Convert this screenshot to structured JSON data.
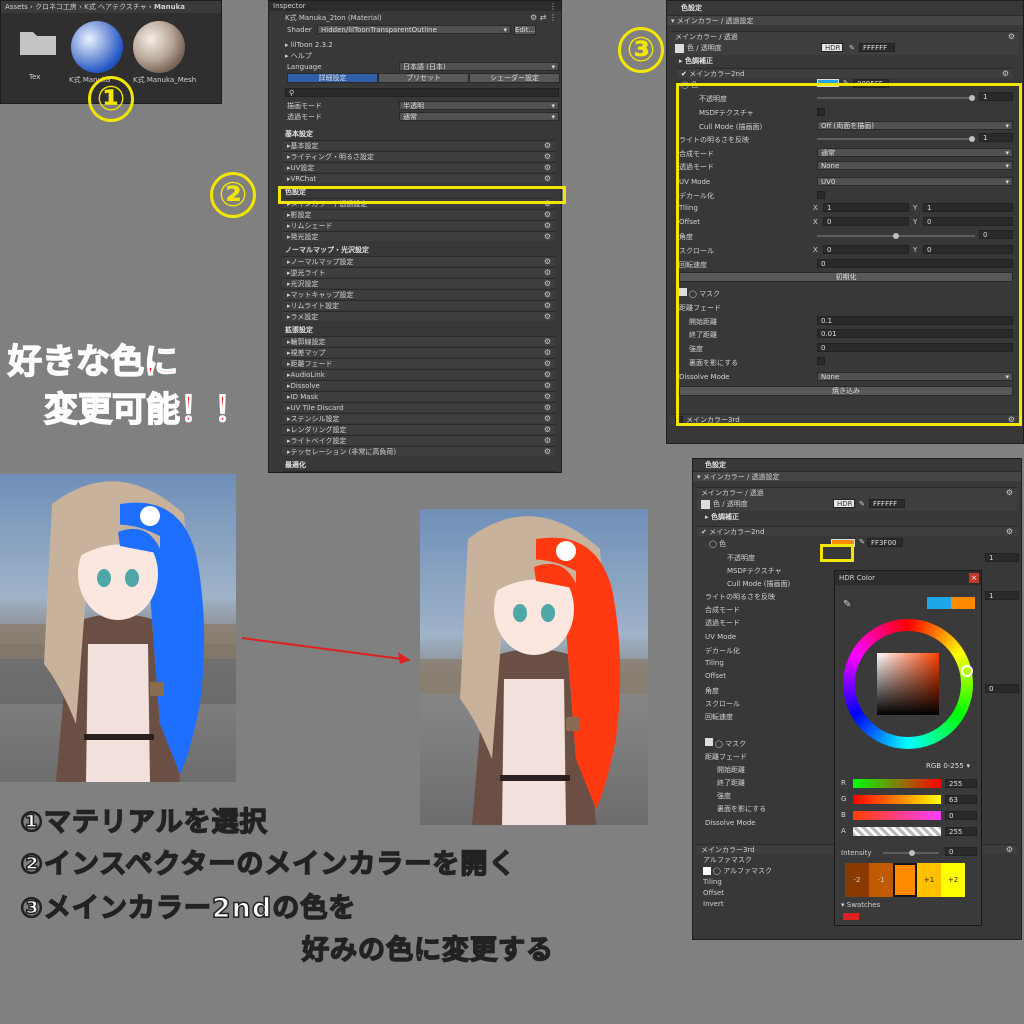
{
  "project": {
    "breadcrumb": [
      "Assets",
      "クロネコ工房",
      "K式 ヘアテクスチャ",
      "Manuka"
    ],
    "items": [
      {
        "label": "Tex"
      },
      {
        "label": "K式 Manuka"
      },
      {
        "label": "K式 Manuka_Mesh"
      }
    ]
  },
  "step_numbers": [
    "①",
    "②",
    "③"
  ],
  "inspector": {
    "tab": "Inspector",
    "title": "K式 Manuka_2ton (Material)",
    "shader_label": "Shader",
    "shader_value": "Hidden/lilToonTransparentOutline",
    "edit": "Edit...",
    "version": "lilToon 2.3.2",
    "help": "ヘルプ",
    "language_label": "Language",
    "language_value": "日本語 (日本)",
    "tabs": [
      "詳細設定",
      "プリセット",
      "シェーダー設定"
    ],
    "render_mode_label": "描画モード",
    "render_mode_value": "半透明",
    "transparent_mode_label": "透過モード",
    "transparent_mode_value": "通常",
    "groups": [
      {
        "title": "基本設定",
        "items": [
          "基本設定",
          "ライティング・明るさ設定",
          "UV設定",
          "VRChat"
        ]
      },
      {
        "title": "色設定",
        "items": [
          "メインカラー / 透過設定",
          "影設定",
          "リムシェード",
          "発光設定"
        ]
      },
      {
        "title": "ノーマルマップ・光沢設定",
        "items": [
          "ノーマルマップ設定",
          "逆光ライト",
          "光沢設定",
          "マットキャップ設定",
          "リムライト設定",
          "ラメ設定"
        ]
      },
      {
        "title": "拡張設定",
        "items": [
          "輪郭線設定",
          "視差マップ",
          "距離フェード",
          "AudioLink",
          "Dissolve",
          "ID Mask",
          "UV Tile Discard",
          "ステンシル設定",
          "レンダリング設定",
          "ライトベイク設定",
          "テッセレーション (非常に高負荷)"
        ]
      },
      {
        "title": "最適化",
        "items": [
          "最適化"
        ]
      }
    ]
  },
  "panel3": {
    "header": "色設定",
    "fold_main": "メインカラー / 透過設定",
    "sub_main": "メインカラー / 透過",
    "color_alpha": "色 / 透明度",
    "hdr": "HDR",
    "main_hex": "FFFFFF",
    "tone": "色調補正",
    "second_title": "メインカラー2nd",
    "color": "色",
    "second_hex": "0095FF",
    "opacity": "不透明度",
    "opacity_val": "1",
    "msdf": "MSDFテクスチャ",
    "cull_label": "Cull Mode (描画面)",
    "cull_value": "Off (両面を描画)",
    "light_label": "ライトの明るさを反映",
    "light_val": "1",
    "blend_label": "合成モード",
    "blend_value": "通常",
    "trans_label": "透過モード",
    "trans_value": "None",
    "uvmode_label": "UV Mode",
    "uvmode_value": "UV0",
    "decal": "デカール化",
    "tiling": "Tiling",
    "tx": "1",
    "ty": "1",
    "offset": "Offset",
    "ox": "0",
    "oy": "0",
    "angle": "角度",
    "angle_val": "0",
    "scroll": "スクロール",
    "sx": "0",
    "sy": "0",
    "rot": "回転速度",
    "rot_val": "0",
    "init": "初期化",
    "mask": "マスク",
    "distfade": "距離フェード",
    "start": "開始距離",
    "start_val": "0.1",
    "end": "終了距離",
    "end_val": "0.01",
    "strength": "強度",
    "strength_val": "0",
    "backface": "裏面を影にする",
    "dissolve": "Dissolve Mode",
    "dissolve_value": "None",
    "bake": "焼き込み",
    "third": "メインカラー3rd"
  },
  "panel4": {
    "header": "色設定",
    "fold_main": "メインカラー / 透過設定",
    "sub_main": "メインカラー / 透過",
    "color_alpha": "色 / 透明度",
    "hdr": "HDR",
    "main_hex": "FFFFFF",
    "tone": "色調補正",
    "second_title": "メインカラー2nd",
    "color": "色",
    "second_hex": "FF3F00",
    "opacity": "不透明度",
    "msdf": "MSDFテクスチャ",
    "cull": "Cull Mode (描画面)",
    "light": "ライトの明るさを反映",
    "blend": "合成モード",
    "trans": "透過モード",
    "uvmode": "UV Mode",
    "decal": "デカール化",
    "tiling": "Tiling",
    "offset": "Offset",
    "angle": "角度",
    "scroll": "スクロール",
    "rot": "回転速度",
    "mask": "マスク",
    "distfade": "距離フェード",
    "start": "開始距離",
    "end": "終了距離",
    "strength": "強度",
    "backface": "裏面を影にする",
    "dissolve": "Dissolve Mode",
    "third": "メインカラー3rd",
    "alphamask": "アルファマスク",
    "alphamask_item": "アルファマスク",
    "tiling2": "Tiling",
    "offset2": "Offset",
    "invert": "Invert",
    "right_vals": [
      "1",
      "1",
      "0"
    ]
  },
  "hdr_picker": {
    "title": "HDR Color",
    "mode": "RGB 0-255",
    "r": "255",
    "g": "63",
    "b": "0",
    "a": "255",
    "intensity_label": "Intensity",
    "intensity": "0",
    "swatch_labels": [
      "-2",
      "-1",
      "",
      "+1",
      "+2"
    ],
    "swatches_label": "Swatches",
    "colors": {
      "old": "#1fa6e8",
      "new": "#ff8a00"
    }
  },
  "red_text": [
    "好きな色に",
    "変更可能！！"
  ],
  "instructions": [
    "①マテリアルを選択",
    "②インスペクターのメインカラーを開く",
    "③メインカラー2ndの色を",
    "好みの色に変更する"
  ],
  "colors": {
    "highlight": "#f2e600",
    "accent_red": "#ff1a1a",
    "blue": "#1e6fff",
    "orange_red": "#ff3a10"
  }
}
